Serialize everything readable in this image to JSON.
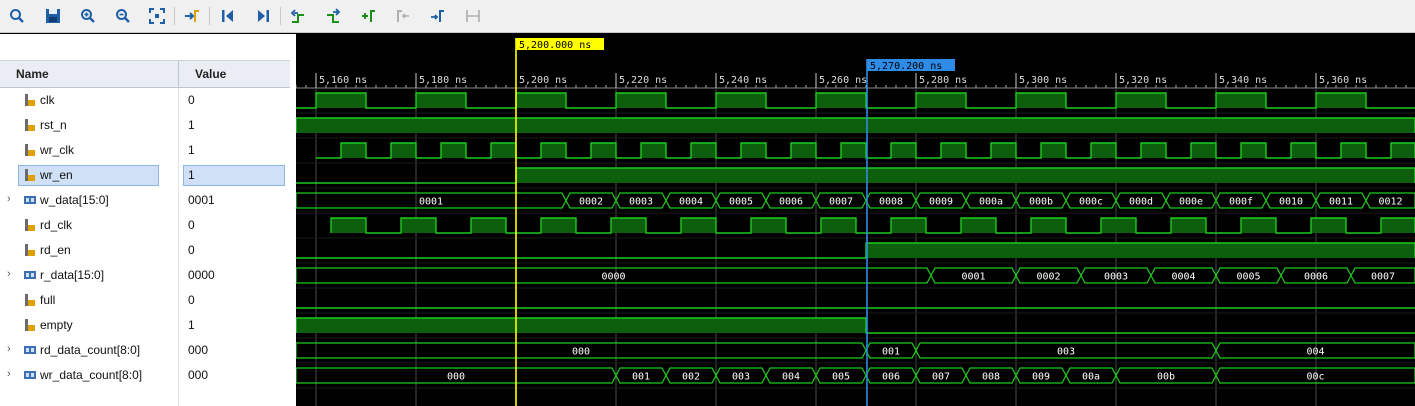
{
  "toolbar": {
    "buttons": [
      {
        "name": "zoom-search-icon"
      },
      {
        "name": "save-icon"
      },
      {
        "name": "zoom-in-icon"
      },
      {
        "name": "zoom-out-icon"
      },
      {
        "name": "zoom-fit-icon"
      },
      {
        "name": "go-to-cursor-icon"
      },
      {
        "name": "go-to-time-zero-icon"
      },
      {
        "name": "go-to-last-time-icon"
      },
      {
        "name": "previous-transition-icon"
      },
      {
        "name": "next-transition-icon"
      },
      {
        "name": "add-marker-icon"
      },
      {
        "name": "previous-marker-icon"
      },
      {
        "name": "next-marker-icon"
      },
      {
        "name": "swap-cursors-icon"
      }
    ]
  },
  "columns": {
    "name": "Name",
    "value": "Value"
  },
  "signals": [
    {
      "name": "clk",
      "value": "0",
      "bus": false
    },
    {
      "name": "rst_n",
      "value": "1",
      "bus": false
    },
    {
      "name": "wr_clk",
      "value": "1",
      "bus": false
    },
    {
      "name": "wr_en",
      "value": "1",
      "bus": false,
      "selected": true
    },
    {
      "name": "w_data[15:0]",
      "value": "0001",
      "bus": true
    },
    {
      "name": "rd_clk",
      "value": "0",
      "bus": false
    },
    {
      "name": "rd_en",
      "value": "0",
      "bus": false
    },
    {
      "name": "r_data[15:0]",
      "value": "0000",
      "bus": true
    },
    {
      "name": "full",
      "value": "0",
      "bus": false
    },
    {
      "name": "empty",
      "value": "1",
      "bus": false
    },
    {
      "name": "rd_data_count[8:0]",
      "value": "000",
      "bus": true
    },
    {
      "name": "wr_data_count[8:0]",
      "value": "000",
      "bus": true
    }
  ],
  "timeline": {
    "ticks": [
      "5,160 ns",
      "5,180 ns",
      "5,200 ns",
      "5,220 ns",
      "5,240 ns",
      "5,260 ns",
      "5,280 ns",
      "5,300 ns",
      "5,320 ns",
      "5,340 ns",
      "5,360 ns"
    ],
    "cursor_main": "5,200.000 ns",
    "cursor_secondary": "5,270.200 ns"
  },
  "waves": {
    "w_data_labels": [
      "0001",
      "0002",
      "0003",
      "0004",
      "0005",
      "0006",
      "0007",
      "0008",
      "0009",
      "000a",
      "000b",
      "000c",
      "000d",
      "000e",
      "000f",
      "0010",
      "0011",
      "0012"
    ],
    "r_data_labels": [
      "0000",
      "0001",
      "0002",
      "0003",
      "0004",
      "0005",
      "0006",
      "0007"
    ],
    "rd_count_labels": [
      "000",
      "001",
      "003",
      "004"
    ],
    "wr_count_labels": [
      "000",
      "001",
      "002",
      "003",
      "004",
      "005",
      "006",
      "007",
      "008",
      "009",
      "00a",
      "00b",
      "00c"
    ]
  },
  "colors": {
    "wave_line": "#1ecb1e",
    "wave_fill": "#0d5f0d",
    "cursor_main": "#ffff00",
    "cursor_secondary": "#2e8ce6",
    "bus_text": "#ffffff",
    "grid": "#4a4a4a"
  }
}
